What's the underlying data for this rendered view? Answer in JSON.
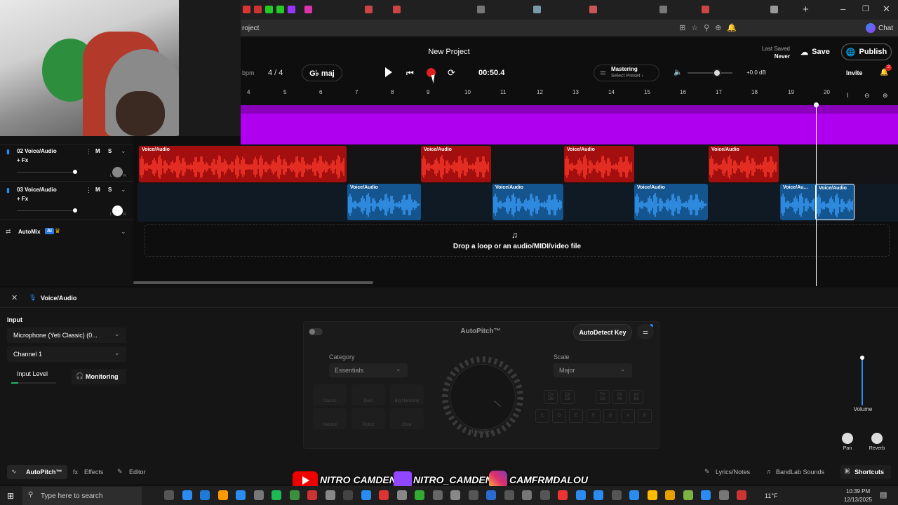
{
  "browser": {
    "url_fragment": "roject",
    "chat_label": "Chat"
  },
  "header": {
    "project_title": "New Project",
    "last_saved_label": "Last Saved",
    "last_saved_value": "Never",
    "save_label": "Save",
    "publish_label": "Publish",
    "invite_label": "Invite",
    "notification_count": "2"
  },
  "transport": {
    "bpm_label": "bpm",
    "time_signature": "4 / 4",
    "key": "G♭ maj",
    "time": "00:50.4",
    "mastering_label": "Mastering",
    "mastering_preset": "Select Preset ›",
    "volume_db": "+0.0 dB"
  },
  "ruler": [
    "4",
    "5",
    "6",
    "7",
    "8",
    "9",
    "10",
    "11",
    "12",
    "13",
    "14",
    "15",
    "16",
    "17",
    "18",
    "19",
    "20"
  ],
  "tracks": [
    {
      "name": "02 Voice/Audio",
      "fx": "+ Fx",
      "mute": "M",
      "solo": "S",
      "pan_r": "R",
      "pan_l": "L"
    },
    {
      "name": "03 Voice/Audio",
      "fx": "+ Fx",
      "mute": "M",
      "solo": "S",
      "pan_r": "R",
      "pan_l": "L"
    }
  ],
  "automix": {
    "label": "AutoMix",
    "badge": "AI"
  },
  "clips": {
    "red": [
      "Voice/Audio",
      "Voice/Audio",
      "Voice/Audio",
      "Voice/Audio"
    ],
    "blue": [
      "Voice/Audio",
      "Voice/Audio",
      "Voice/Audio",
      "Voice/Au...",
      "Voice/Audio"
    ]
  },
  "drop_zone": "Drop a loop or an audio/MIDI/video file",
  "bottom_panel": {
    "track_title": "Voice/Audio",
    "input_label": "Input",
    "input_device": "Microphone (Yeti Classic) (0...",
    "channel": "Channel 1",
    "input_level_label": "Input Level",
    "monitoring_label": "Monitoring",
    "volume_label": "Volume",
    "pan_label": "Pan",
    "reverb_label": "Reverb"
  },
  "autopitch": {
    "title": "AutoPitch™",
    "detect_label": "AutoDetect Key",
    "category_label": "Category",
    "category_value": "Essentials",
    "scale_label": "Scale",
    "scale_value": "Major",
    "knob_label": "Heaviest",
    "presets": [
      "Classic",
      "Duet",
      "Big Harmony",
      "Natural",
      "Robot",
      "Choir"
    ],
    "key_row1": [
      "C#\nDb",
      "D#\nEb",
      "F#\nGb",
      "G#\nAb",
      "A#\nBb"
    ],
    "key_row2": [
      "C",
      "D",
      "E",
      "F",
      "G",
      "A",
      "B"
    ]
  },
  "bottom_tabs": {
    "autopitch": "AutoPitch™",
    "effects": "Effects",
    "editor": "Editor",
    "lyrics": "Lyrics/Notes",
    "sounds": "BandLab Sounds",
    "shortcuts": "Shortcuts"
  },
  "overlay": {
    "youtube": "NITRO CAMDEN",
    "twitch": "NITRO_CAMDEN",
    "instagram": "CAMFRMDALOU"
  },
  "taskbar": {
    "search_placeholder": "Type here to search",
    "weather": "11°F",
    "time": "10:39 PM",
    "date": "12/13/2025"
  },
  "colors": {
    "accent_purple": "#b000f0",
    "clip_red": "#c81414",
    "clip_blue": "#1e7ad6",
    "record_red": "#e02020"
  }
}
